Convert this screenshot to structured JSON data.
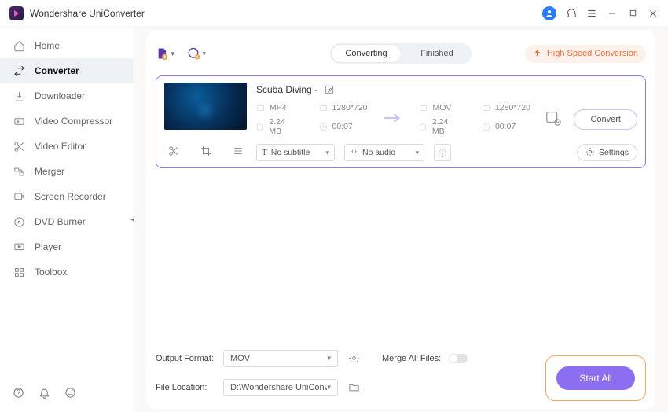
{
  "app": {
    "title": "Wondershare UniConverter"
  },
  "sidebar": {
    "items": [
      {
        "label": "Home"
      },
      {
        "label": "Converter"
      },
      {
        "label": "Downloader"
      },
      {
        "label": "Video Compressor"
      },
      {
        "label": "Video Editor"
      },
      {
        "label": "Merger"
      },
      {
        "label": "Screen Recorder"
      },
      {
        "label": "DVD Burner"
      },
      {
        "label": "Player"
      },
      {
        "label": "Toolbox"
      }
    ]
  },
  "tabs": {
    "converting": "Converting",
    "finished": "Finished"
  },
  "hs": {
    "label": "High Speed Conversion"
  },
  "item": {
    "name": "Scuba Diving  -",
    "src": {
      "format": "MP4",
      "res": "1280*720",
      "size": "2.24 MB",
      "dur": "00:07"
    },
    "dst": {
      "format": "MOV",
      "res": "1280*720",
      "size": "2.24 MB",
      "dur": "00:07"
    },
    "subtitle": "No subtitle",
    "audio": "No audio",
    "convert": "Convert",
    "settings": "Settings"
  },
  "footer": {
    "outputFormatLabel": "Output Format:",
    "outputFormat": "MOV",
    "fileLocationLabel": "File Location:",
    "fileLocation": "D:\\Wondershare UniConvert",
    "mergeLabel": "Merge All Files:",
    "startAll": "Start All"
  }
}
